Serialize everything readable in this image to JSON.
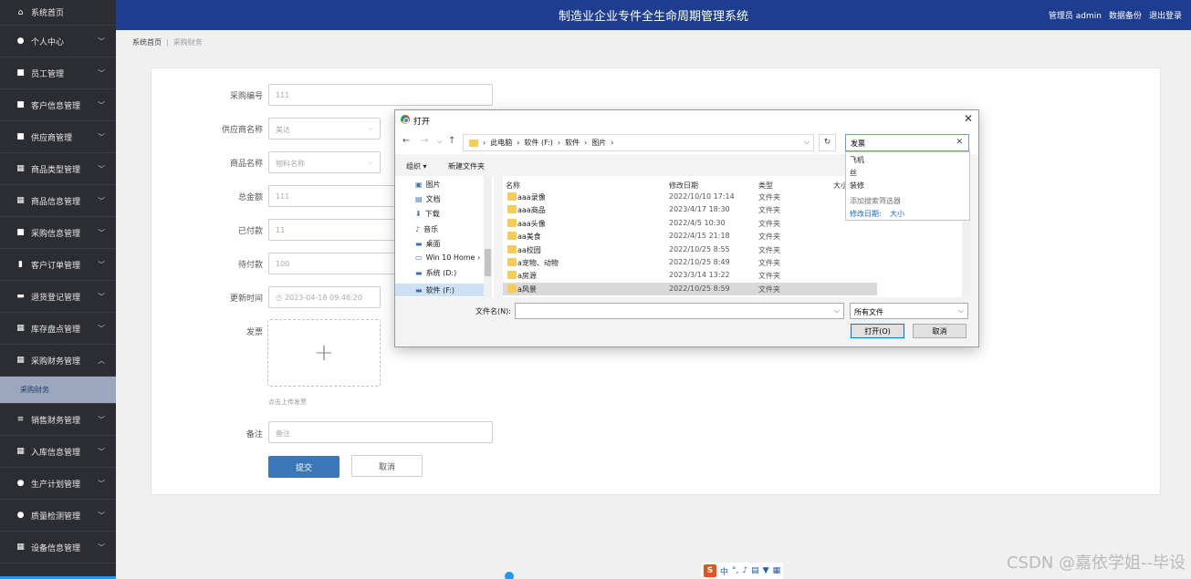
{
  "header": {
    "title": "制造业企业专件全生命周期管理系统",
    "admin": "管理员 admin",
    "backup": "数据备份",
    "logout": "退出登录"
  },
  "sidebar": {
    "items": [
      {
        "label": "系统首页",
        "icon": "home-icon",
        "glyph": "⌂"
      },
      {
        "label": "个人中心",
        "icon": "user-icon",
        "glyph": "●"
      },
      {
        "label": "员工管理",
        "icon": "clipboard-icon",
        "glyph": "■"
      },
      {
        "label": "客户信息管理",
        "icon": "clipboard-icon",
        "glyph": "■"
      },
      {
        "label": "供应商管理",
        "icon": "chat-icon",
        "glyph": "■"
      },
      {
        "label": "商品类型管理",
        "icon": "grid-icon",
        "glyph": "▦"
      },
      {
        "label": "商品信息管理",
        "icon": "grid-icon",
        "glyph": "▦"
      },
      {
        "label": "采购信息管理",
        "icon": "clipboard-icon",
        "glyph": "■"
      },
      {
        "label": "客户订单管理",
        "icon": "chart-icon",
        "glyph": "▮"
      },
      {
        "label": "退货登记管理",
        "icon": "ticket-icon",
        "glyph": "▬"
      },
      {
        "label": "库存盘点管理",
        "icon": "grid-icon",
        "glyph": "▦"
      },
      {
        "label": "采购财务管理",
        "icon": "grid-icon",
        "glyph": "▦"
      },
      {
        "label": "销售财务管理",
        "icon": "list-icon",
        "glyph": "≡"
      },
      {
        "label": "入库信息管理",
        "icon": "grid-icon",
        "glyph": "▦"
      },
      {
        "label": "生产计划管理",
        "icon": "pin-icon",
        "glyph": "●"
      },
      {
        "label": "质量检测管理",
        "icon": "user-icon",
        "glyph": "●"
      },
      {
        "label": "设备信息管理",
        "icon": "grid-icon",
        "glyph": "▦"
      }
    ],
    "active_sub": "采购财务"
  },
  "breadcrumb": {
    "home": "系统首页",
    "current": "采购财务"
  },
  "form": {
    "purchase_no": {
      "label": "采购编号",
      "value": "111"
    },
    "supplier": {
      "label": "供应商名称",
      "value": "美达"
    },
    "product": {
      "label": "商品名称",
      "placeholder": "物料名称"
    },
    "total": {
      "label": "总金额",
      "value": "111"
    },
    "paid": {
      "label": "已付款",
      "value": "11"
    },
    "pending": {
      "label": "待付款",
      "value": "100"
    },
    "updated": {
      "label": "更新时间",
      "value": "2023-04-18 09:48:20"
    },
    "invoice": {
      "label": "发票",
      "hint": "点击上传发票"
    },
    "remark": {
      "label": "备注",
      "placeholder": "备注"
    },
    "submit": "提交",
    "cancel": "取消"
  },
  "dialog": {
    "title": "打开",
    "path": [
      "此电脑",
      "软件 (F:)",
      "软件",
      "图片"
    ],
    "search_value": "发票",
    "toolbar": {
      "organize": "组织 ▾",
      "new_folder": "新建文件夹"
    },
    "tree": [
      "图片",
      "文档",
      "下载",
      "音乐",
      "桌面",
      "Win 10 Home ›",
      "系统 (D:)",
      "软件 (F:)"
    ],
    "columns": {
      "name": "名称",
      "date": "修改日期",
      "type": "类型",
      "size": "大小"
    },
    "files": [
      {
        "name": "aaa录像",
        "date": "2022/10/10 17:14",
        "type": "文件夹"
      },
      {
        "name": "aaa商品",
        "date": "2023/4/17 18:30",
        "type": "文件夹"
      },
      {
        "name": "aaa头像",
        "date": "2022/4/5 10:30",
        "type": "文件夹"
      },
      {
        "name": "aa美食",
        "date": "2022/4/15 21:18",
        "type": "文件夹"
      },
      {
        "name": "aa校园",
        "date": "2022/10/25 8:55",
        "type": "文件夹"
      },
      {
        "name": "a宠物、动物",
        "date": "2022/10/25 8:49",
        "type": "文件夹"
      },
      {
        "name": "a房源",
        "date": "2023/3/14 13:22",
        "type": "文件夹"
      },
      {
        "name": "a风景",
        "date": "2022/10/25 8:59",
        "type": "文件夹"
      }
    ],
    "filename_label": "文件名(N):",
    "filetype": "所有文件",
    "open": "打开(O)",
    "cancel": "取消",
    "suggestions": [
      "飞机",
      "丝",
      "装修"
    ],
    "suggest_hint": "添加搜索筛选器",
    "suggest_link1": "修改日期:",
    "suggest_link2": "大小"
  },
  "ime": "中",
  "watermark": "CSDN @嘉依学姐--毕设"
}
